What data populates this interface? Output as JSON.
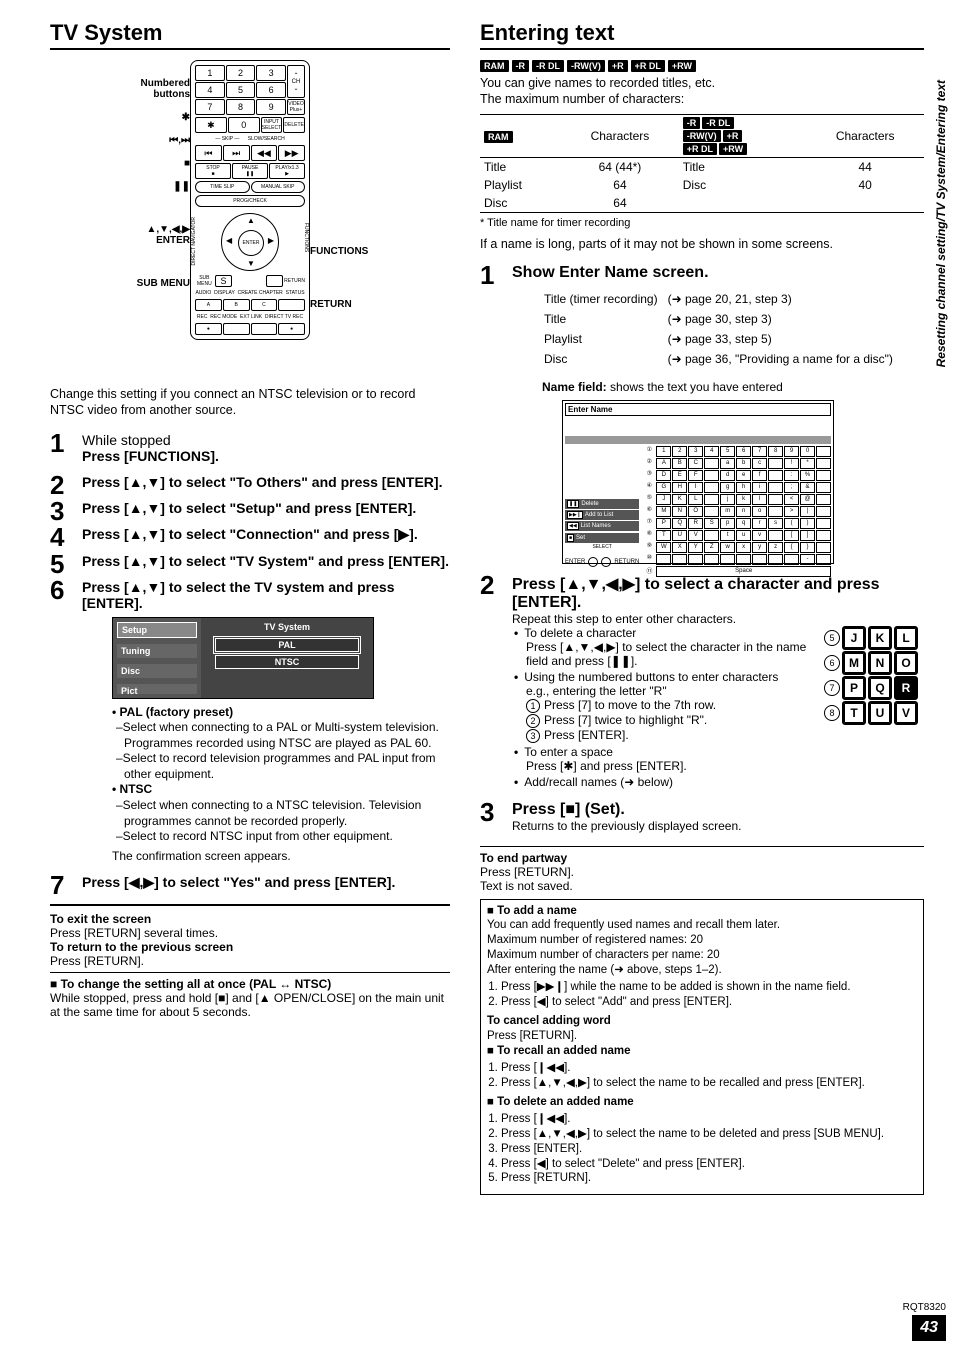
{
  "left": {
    "title": "TV System",
    "callouts": {
      "numbered": "Numbered buttons",
      "skip": "⏮,⏭",
      "star": "✱",
      "stop": "■",
      "pause": "❚❚",
      "nav": "▲,▼,◀,▶ ENTER",
      "submenu": "SUB MENU",
      "functions": "FUNCTIONS",
      "return": "RETURN"
    },
    "intro": "Change this setting if you connect an NTSC television or to record NTSC video from another source.",
    "steps": {
      "s1a": "While stopped",
      "s1b": "Press [FUNCTIONS].",
      "s2": "Press [▲,▼] to select \"To Others\" and press [ENTER].",
      "s3": "Press [▲,▼] to select \"Setup\" and press [ENTER].",
      "s4": "Press [▲,▼] to select \"Connection\" and press [▶].",
      "s5": "Press [▲,▼] to select \"TV System\" and press [ENTER].",
      "s6": "Press [▲,▼] to select the TV system and press [ENTER].",
      "s7": "Press [◀,▶] to select \"Yes\" and press [ENTER]."
    },
    "setupbox": {
      "hdr": "TV System",
      "tabs": [
        "Setup",
        "Tuning",
        "Disc",
        "Pict"
      ],
      "opts": [
        "PAL",
        "NTSC"
      ]
    },
    "bullets": {
      "pal_h": "PAL (factory preset)",
      "pal1": "–Select when connecting to a PAL or Multi-system television. Programmes recorded using NTSC are played as PAL 60.",
      "pal2": "–Select to record television programmes and PAL input from other equipment.",
      "ntsc_h": "NTSC",
      "ntsc1": "–Select when connecting to a NTSC television. Television programmes cannot be recorded properly.",
      "ntsc2": "–Select to record NTSC input from other equipment.",
      "confirm": "The confirmation screen appears."
    },
    "foot": {
      "exit_h": "To exit the screen",
      "exit_b": "Press [RETURN] several times.",
      "prev_h": "To return to the previous screen",
      "prev_b": "Press [RETURN].",
      "change_h": "To change the setting all at once (PAL ↔ NTSC)",
      "change_b": "While stopped, press and hold [■] and [▲ OPEN/CLOSE] on the main unit at the same time for about 5 seconds."
    }
  },
  "right": {
    "title": "Entering text",
    "badges": [
      "RAM",
      "-R",
      "-R DL",
      "-RW(V)",
      "+R",
      "+R DL",
      "+RW"
    ],
    "intro1": "You can give names to recorded titles, etc.",
    "intro2": "The maximum number of characters:",
    "table": {
      "col1_badge": "RAM",
      "col2_h": "Characters",
      "col3_badges_r1": [
        "-R",
        "-R DL"
      ],
      "col3_badges_r2": [
        "-RW(V)",
        "+R"
      ],
      "col3_badges_r3": [
        "+R DL",
        "+RW"
      ],
      "col4_h": "Characters",
      "rowsL": [
        {
          "k": "Title",
          "v": "64 (44*)"
        },
        {
          "k": "Playlist",
          "v": "64"
        },
        {
          "k": "Disc",
          "v": "64"
        }
      ],
      "rowsR": [
        {
          "k": "Title",
          "v": "44"
        },
        {
          "k": "Disc",
          "v": "40"
        }
      ]
    },
    "aster": "* Title name for timer recording",
    "longnote": "If a name is long, parts of it may not be shown in some screens.",
    "bigsteps": {
      "s1": "Show Enter Name screen.",
      "refs": [
        {
          "a": "Title (timer recording)",
          "b": "(➜ page 20, 21, step 3)"
        },
        {
          "a": "Title",
          "b": "(➜ page 30, step 3)"
        },
        {
          "a": "Playlist",
          "b": "(➜ page 33, step 5)"
        },
        {
          "a": "Disc",
          "b": "(➜ page 36, \"Providing a name for a disc\")"
        }
      ],
      "name_field_h": "Name field:",
      "name_field_b": " shows the text you have entered",
      "s2": "Press [▲,▼,◀,▶] to select a character and press [ENTER].",
      "s2_sub1": "Repeat this step to enter other characters.",
      "s2_del_h": "To delete a character",
      "s2_del_b": "Press [▲,▼,◀,▶] to select the character in the name field and press [❚❚].",
      "s2_num_h": "Using the numbered buttons to enter characters",
      "s2_num_b": "e.g., entering the letter \"R\"",
      "s2_num_1": "Press [7] to move to the 7th row.",
      "s2_num_2": "Press [7] twice to highlight \"R\".",
      "s2_num_3": "Press [ENTER].",
      "s2_space_h": "To enter a space",
      "s2_space_b": "Press [✱] and press [ENTER].",
      "s2_add": "Add/recall names (➜ below)",
      "s3": "Press [■] (Set).",
      "s3_sub": "Returns to the previously displayed screen."
    },
    "endpartway_h": "To end partway",
    "endpartway_1": "Press [RETURN].",
    "endpartway_2": "Text is not saved.",
    "box": {
      "add_h": "To add a name",
      "add_1": "You can add frequently used names and recall them later.",
      "add_2": "Maximum number of registered names: 20",
      "add_3": "Maximum number of characters per name: 20",
      "add_4": "After entering the name (➜ above, steps 1–2).",
      "add_s1": "Press [▶▶❙] while the name to be added is shown in the name field.",
      "add_s2": "Press [◀] to select \"Add\" and press [ENTER].",
      "cancel_h": "To cancel adding word",
      "cancel_b": "Press [RETURN].",
      "recall_h": "To recall an added name",
      "recall_s1": "Press [❙◀◀].",
      "recall_s2": "Press [▲,▼,◀,▶] to select the name to be recalled and press [ENTER].",
      "del_h": "To delete an added name",
      "del_s1": "Press [❙◀◀].",
      "del_s2": "Press [▲,▼,◀,▶] to select the name to be deleted and press [SUB MENU].",
      "del_s3": "Press [ENTER].",
      "del_s4": "Press [◀] to select \"Delete\" and press [ENTER].",
      "del_s5": "Press [RETURN]."
    },
    "enter_name_hd": "Enter Name",
    "en_cmds": {
      "del": "Delete",
      "add": "Add to List",
      "list": "List Names",
      "set": "Set",
      "select": "SELECT",
      "enter": "ENTER",
      "return": "RETURN"
    },
    "zoom": {
      "rows": [
        {
          "n": "5",
          "keys": [
            "J",
            "K",
            "L"
          ]
        },
        {
          "n": "6",
          "keys": [
            "M",
            "N",
            "O"
          ]
        },
        {
          "n": "7",
          "keys": [
            "P",
            "Q",
            "R"
          ],
          "hi": 2,
          "extra": "7"
        },
        {
          "n": "8",
          "keys": [
            "T",
            "U",
            "V"
          ]
        }
      ]
    }
  },
  "side_text": "Resetting channel setting/TV System/Entering text",
  "doc_num": "RQT8320",
  "page_num": "43"
}
